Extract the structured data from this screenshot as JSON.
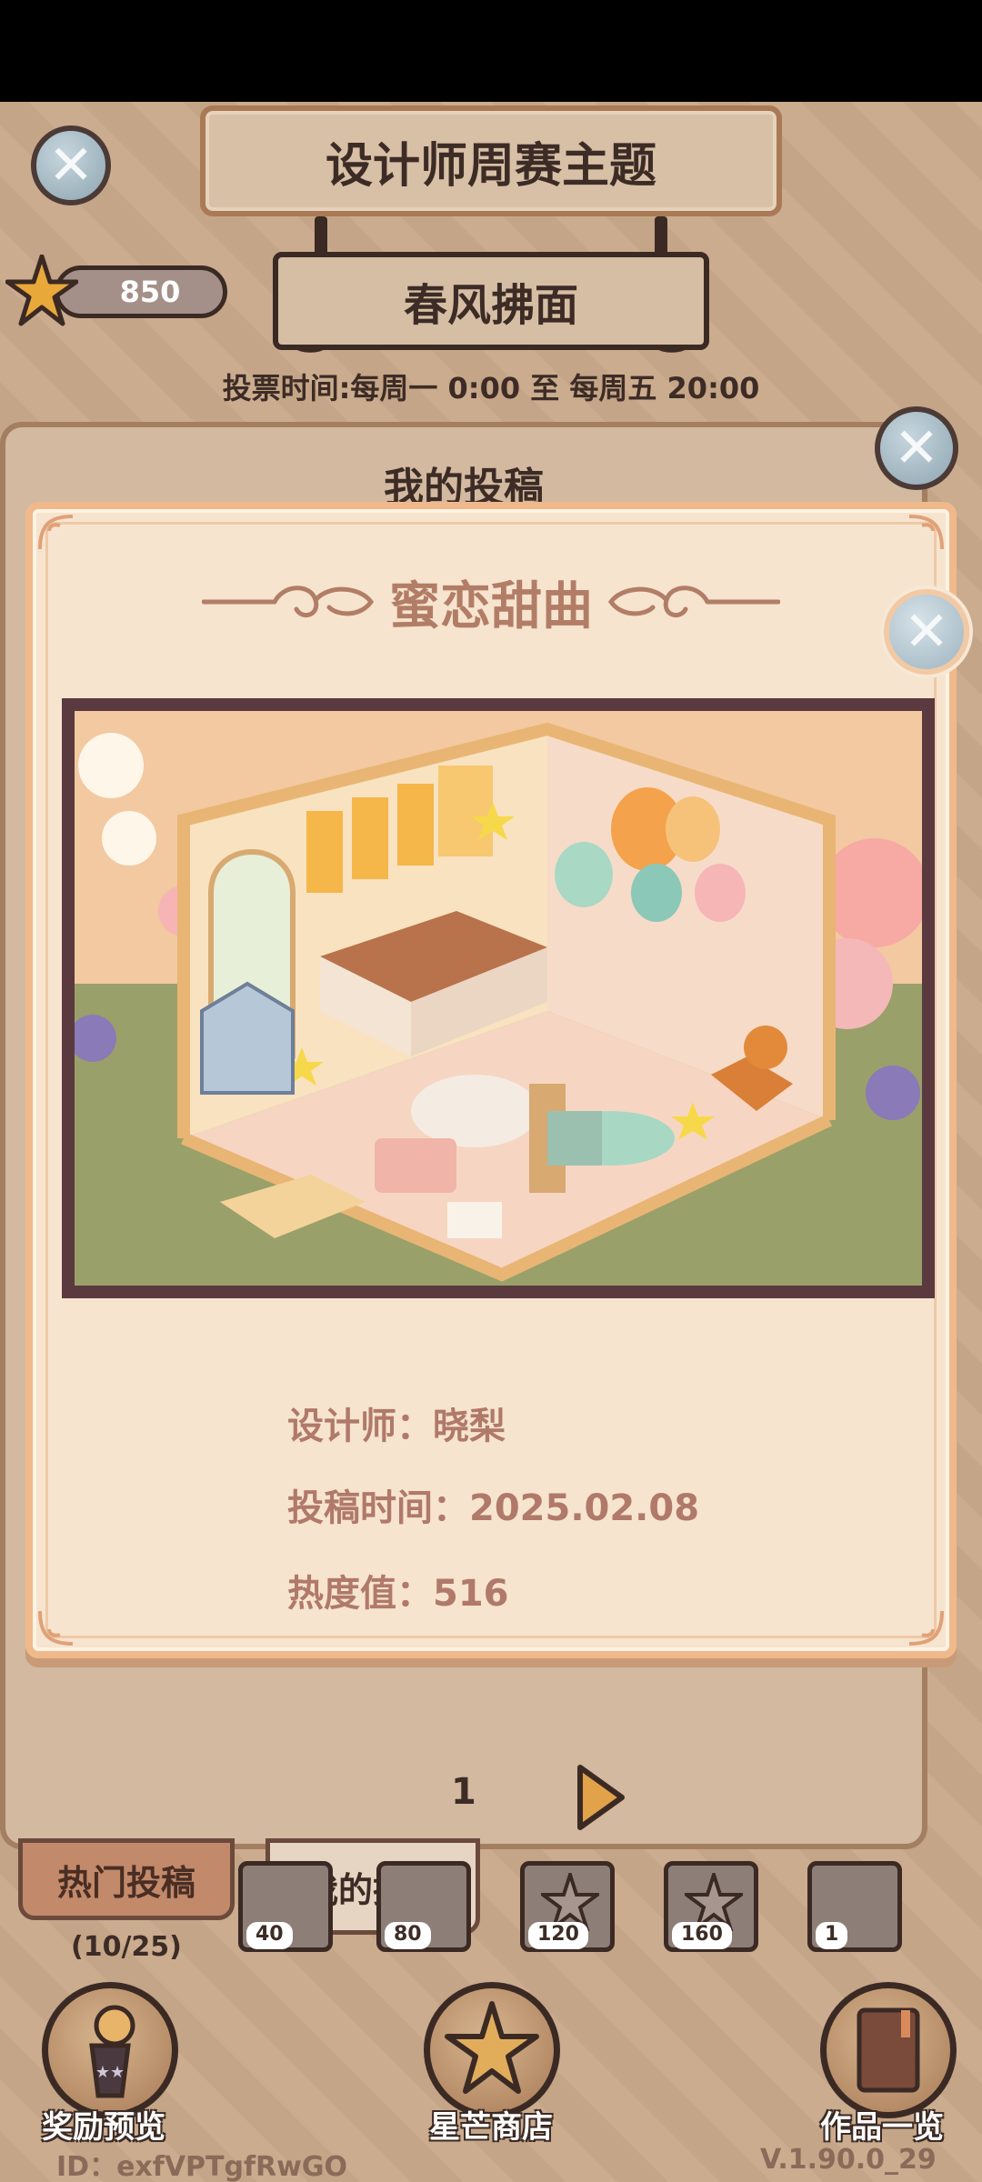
{
  "header": {
    "theme_title": "设计师周赛主题",
    "subtheme": "春风拂面",
    "star_count": "850",
    "vote_time": "投票时间:每周一 0:00 至 每周五 20:00"
  },
  "back_panel": {
    "title": "我的投稿",
    "page_number": "1"
  },
  "tabs": {
    "hot": "热门投稿",
    "mine": "我的投稿",
    "progress": "(10/25)"
  },
  "milestones": [
    "40",
    "80",
    "120",
    "160",
    "1"
  ],
  "bottom_bar": {
    "rewards": "奖励预览",
    "shop": "星芒商店",
    "works": "作品一览",
    "user_id": "ID：exfVPTgfRwGO",
    "version": "V.1.90.0_29"
  },
  "modal": {
    "title": "蜜恋甜曲",
    "designer": "设计师：晓梨",
    "submit_time": "投稿时间：2025.02.08",
    "popularity": "热度值：516"
  },
  "colors": {
    "modal_bg": "#f6e4cf",
    "modal_border": "#f0b98c",
    "accent_text": "#b0796a",
    "dark_text": "#3d2c26",
    "frame": "#5a3a3e"
  }
}
